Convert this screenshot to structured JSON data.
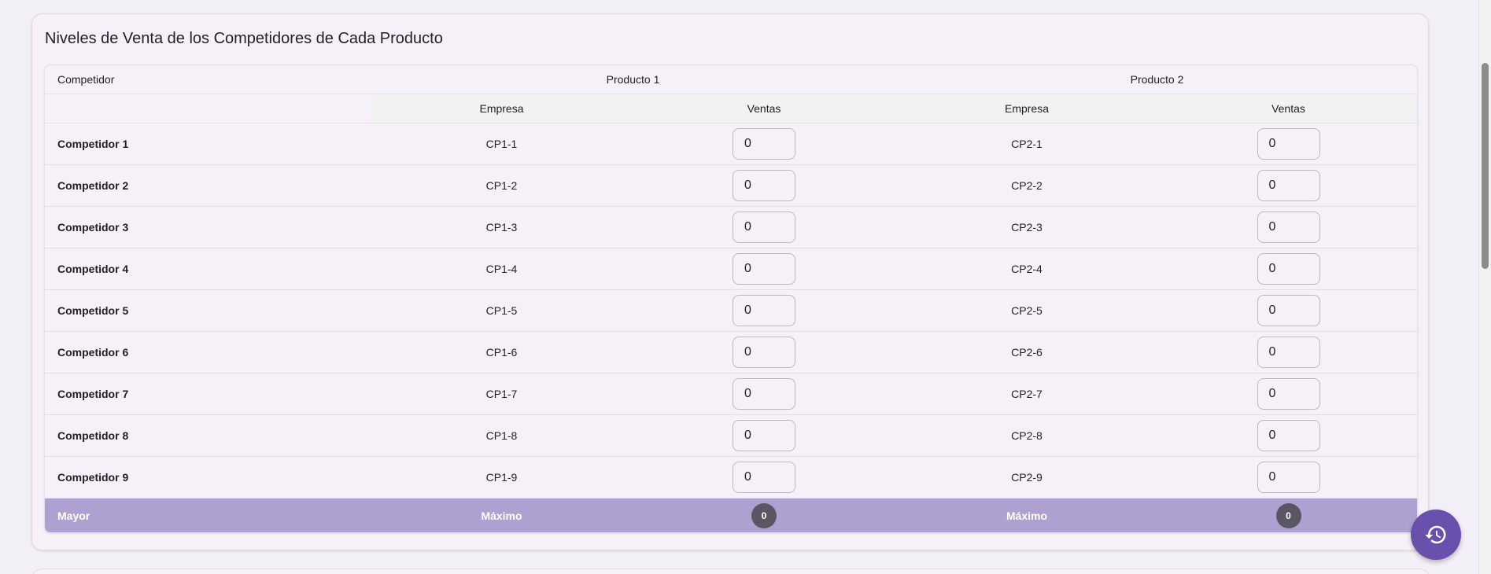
{
  "section": {
    "title": "Niveles de Venta de los Competidores de Cada Producto"
  },
  "table": {
    "header": {
      "competitor": "Competidor",
      "product1": "Producto 1",
      "product2": "Producto 2",
      "company": "Empresa",
      "sales": "Ventas"
    },
    "rows": [
      {
        "name": "Competidor 1",
        "p1_company": "CP1-1",
        "p1_sales": "0",
        "p2_company": "CP2-1",
        "p2_sales": "0"
      },
      {
        "name": "Competidor 2",
        "p1_company": "CP1-2",
        "p1_sales": "0",
        "p2_company": "CP2-2",
        "p2_sales": "0"
      },
      {
        "name": "Competidor 3",
        "p1_company": "CP1-3",
        "p1_sales": "0",
        "p2_company": "CP2-3",
        "p2_sales": "0"
      },
      {
        "name": "Competidor 4",
        "p1_company": "CP1-4",
        "p1_sales": "0",
        "p2_company": "CP2-4",
        "p2_sales": "0"
      },
      {
        "name": "Competidor 5",
        "p1_company": "CP1-5",
        "p1_sales": "0",
        "p2_company": "CP2-5",
        "p2_sales": "0"
      },
      {
        "name": "Competidor 6",
        "p1_company": "CP1-6",
        "p1_sales": "0",
        "p2_company": "CP2-6",
        "p2_sales": "0"
      },
      {
        "name": "Competidor 7",
        "p1_company": "CP1-7",
        "p1_sales": "0",
        "p2_company": "CP2-7",
        "p2_sales": "0"
      },
      {
        "name": "Competidor 8",
        "p1_company": "CP1-8",
        "p1_sales": "0",
        "p2_company": "CP2-8",
        "p2_sales": "0"
      },
      {
        "name": "Competidor 9",
        "p1_company": "CP1-9",
        "p1_sales": "0",
        "p2_company": "CP2-9",
        "p2_sales": "0"
      }
    ],
    "footer": {
      "label": "Mayor",
      "p1_label": "Máximo",
      "p1_value": "0",
      "p2_label": "Máximo",
      "p2_value": "0"
    }
  },
  "fab": {
    "icon": "history-icon"
  },
  "colors": {
    "background": "#f3eff6",
    "footer_row": "#aea0d0",
    "badge": "#5b5663",
    "fab": "#6a50ad"
  }
}
